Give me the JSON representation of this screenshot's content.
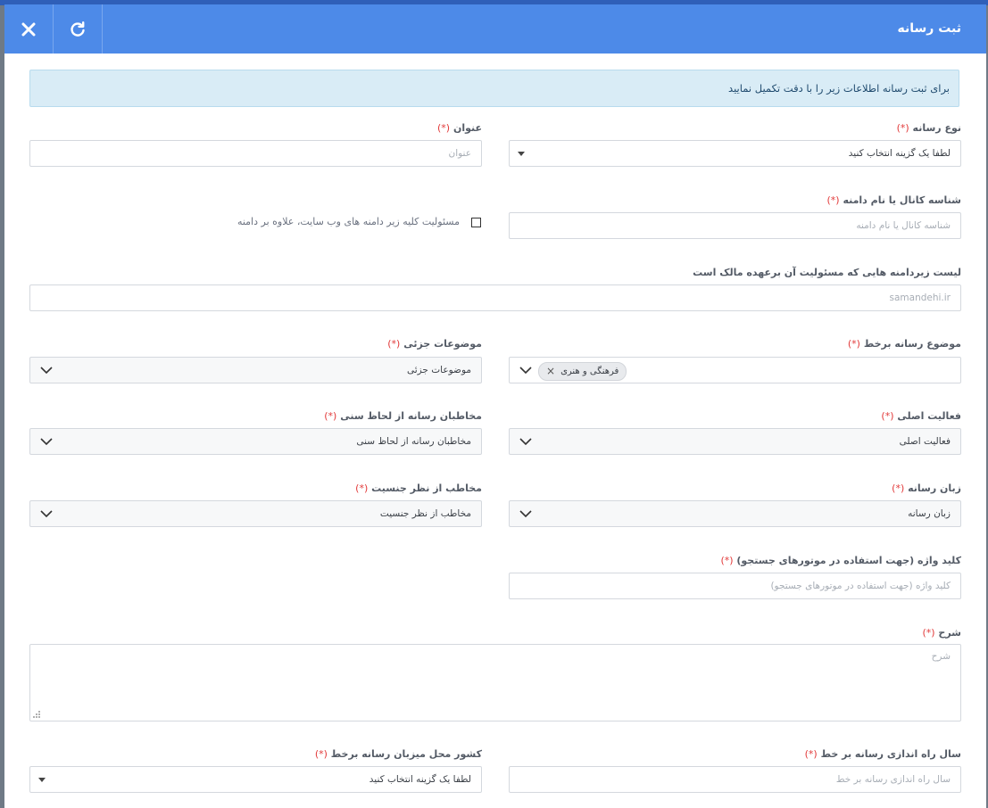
{
  "dialog": {
    "title": "ثبت رسانه",
    "alert_text": "برای ثبت رسانه اطلاعات زیر را با دقت تکمیل نمایید"
  },
  "form": {
    "required_mark": "(*)",
    "media_type": {
      "label": "نوع رسانه",
      "value": "لطفا یک گزینه انتخاب کنید"
    },
    "title_field": {
      "label": "عنوان",
      "placeholder": "عنوان"
    },
    "channel_id": {
      "label": "شناسه کانال یا نام دامنه",
      "placeholder": "شناسه کانال یا نام دامنه"
    },
    "subdomain_checkbox": {
      "label": "مسئولیت کلیه زیر دامنه های وب سایت، علاوه بر دامنه"
    },
    "subdomain_list": {
      "label": "لیست زیردامنه هایی که مسئولیت آن برعهده مالک است",
      "placeholder": "samandehi.ir"
    },
    "online_topic": {
      "label": "موضوع رسانه برخط",
      "tag": "فرهنگی و هنری",
      "tag_remove": "×"
    },
    "sub_topics": {
      "label": "موضوعات جزئی",
      "value": "موضوعات جزئی"
    },
    "main_activity": {
      "label": "فعالیت اصلی",
      "value": "فعالیت اصلی"
    },
    "age_audience": {
      "label": "مخاطبان رسانه از لحاظ سنی",
      "value": "مخاطبان رسانه از لحاظ سنی"
    },
    "language": {
      "label": "زبان رسانه",
      "value": "زبان رسانه"
    },
    "gender_audience": {
      "label": "مخاطب از نظر جنسیت",
      "value": "مخاطب از نظر جنسیت"
    },
    "keywords": {
      "label": "کلید واژه (جهت استفاده در موتورهای جستجو)",
      "placeholder": "کلید واژه (جهت استفاده در موتورهای جستجو)"
    },
    "description": {
      "label": "شرح",
      "placeholder": "شرح"
    },
    "launch_year": {
      "label": "سال راه اندازی رسانه بر خط",
      "placeholder": "سال راه اندازی رسانه بر خط"
    },
    "host_country": {
      "label": "کشور محل میزبان رسانه برخط",
      "value": "لطفا یک گزینه انتخاب کنید"
    }
  }
}
